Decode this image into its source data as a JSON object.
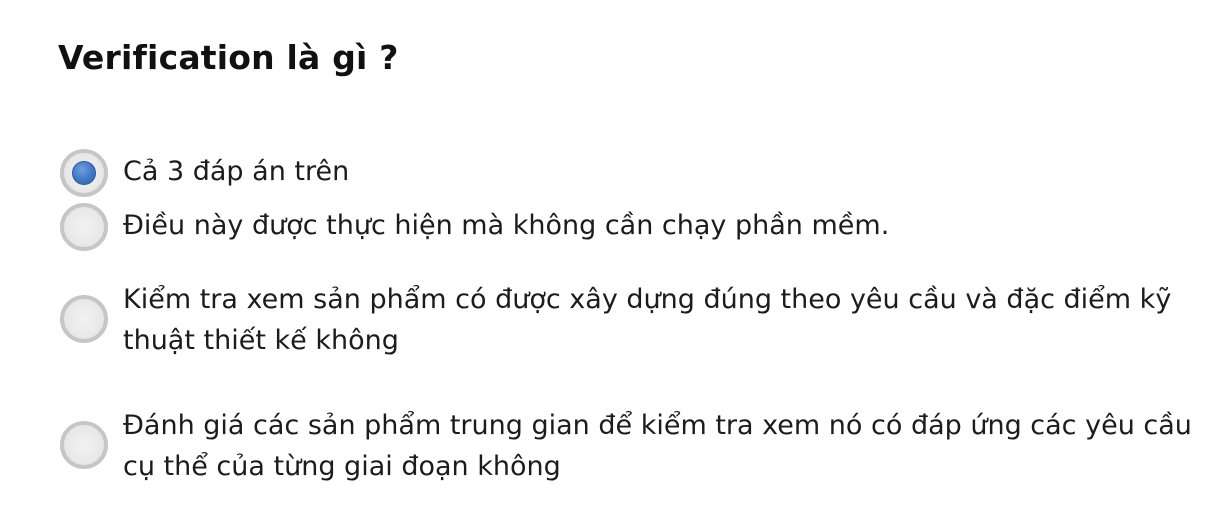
{
  "question": {
    "title": "Verification là gì ?"
  },
  "options": [
    {
      "label": "Cả 3 đáp án trên",
      "selected": true
    },
    {
      "label": "Điều này được thực hiện mà không cần chạy phần mềm.",
      "selected": false
    },
    {
      "label": "Kiểm tra xem sản phẩm có được xây dựng đúng theo yêu cầu và đặc điểm kỹ thuật thiết kế không",
      "selected": false
    },
    {
      "label": "Đánh giá các sản phẩm trung gian để kiểm tra xem nó có đáp ứng các yêu cầu cụ thể của từng giai đoạn không",
      "selected": false
    }
  ],
  "colors": {
    "radio_selected": "#3f77c6",
    "radio_border": "#c6c6c6",
    "text": "#1c1c1c"
  }
}
